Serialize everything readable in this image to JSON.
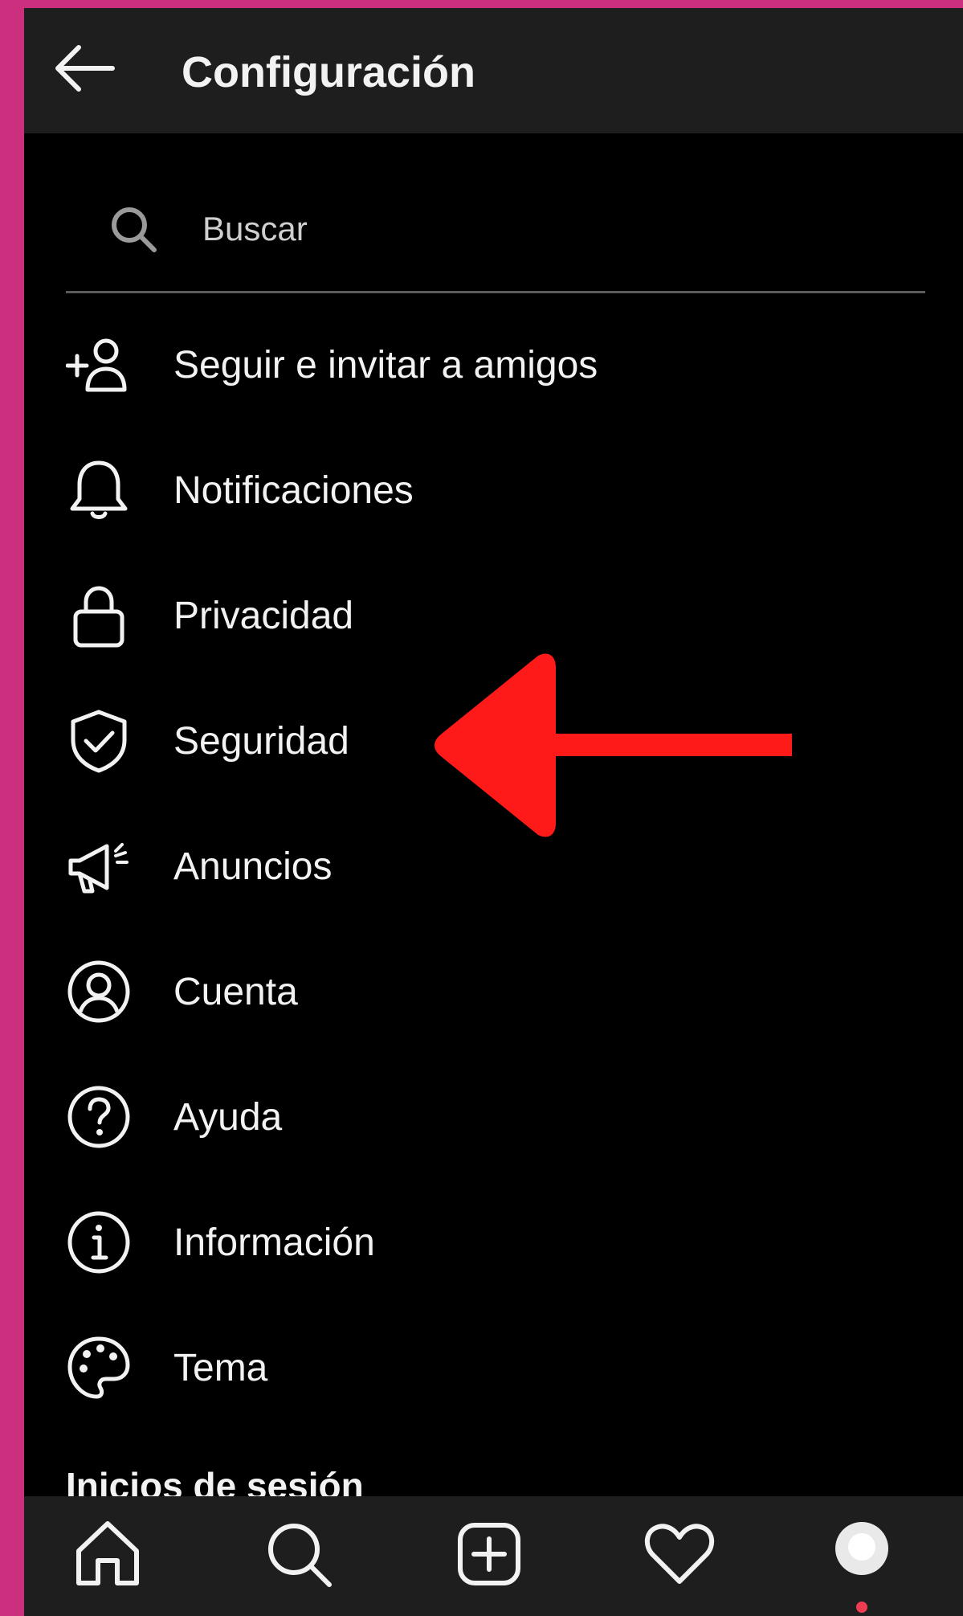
{
  "header": {
    "title": "Configuración",
    "back_icon": "arrow-left-icon"
  },
  "search": {
    "placeholder": "Buscar",
    "value": "",
    "icon": "search-icon"
  },
  "menu": {
    "items": [
      {
        "label": "Seguir e invitar a amigos",
        "icon": "add-person-icon"
      },
      {
        "label": "Notificaciones",
        "icon": "bell-icon"
      },
      {
        "label": "Privacidad",
        "icon": "lock-icon"
      },
      {
        "label": "Seguridad",
        "icon": "shield-check-icon"
      },
      {
        "label": "Anuncios",
        "icon": "megaphone-icon"
      },
      {
        "label": "Cuenta",
        "icon": "user-circle-icon"
      },
      {
        "label": "Ayuda",
        "icon": "help-circle-icon"
      },
      {
        "label": "Información",
        "icon": "info-circle-icon"
      },
      {
        "label": "Tema",
        "icon": "palette-icon"
      }
    ]
  },
  "section": {
    "heading": "Inicios de sesión"
  },
  "annotation": {
    "type": "arrow",
    "points_to": "Seguridad",
    "color": "#ff1a1a"
  },
  "bottom_nav": {
    "items": [
      {
        "icon": "home-icon"
      },
      {
        "icon": "search-icon"
      },
      {
        "icon": "create-post-icon"
      },
      {
        "icon": "heart-icon"
      },
      {
        "icon": "profile-avatar"
      }
    ],
    "notification_dot_color": "#ee3d51"
  },
  "colors": {
    "page_background": "#cc2f7e",
    "screen_background": "#000000",
    "bar_background": "#1e1e1e",
    "text": "#f2f2f2"
  }
}
